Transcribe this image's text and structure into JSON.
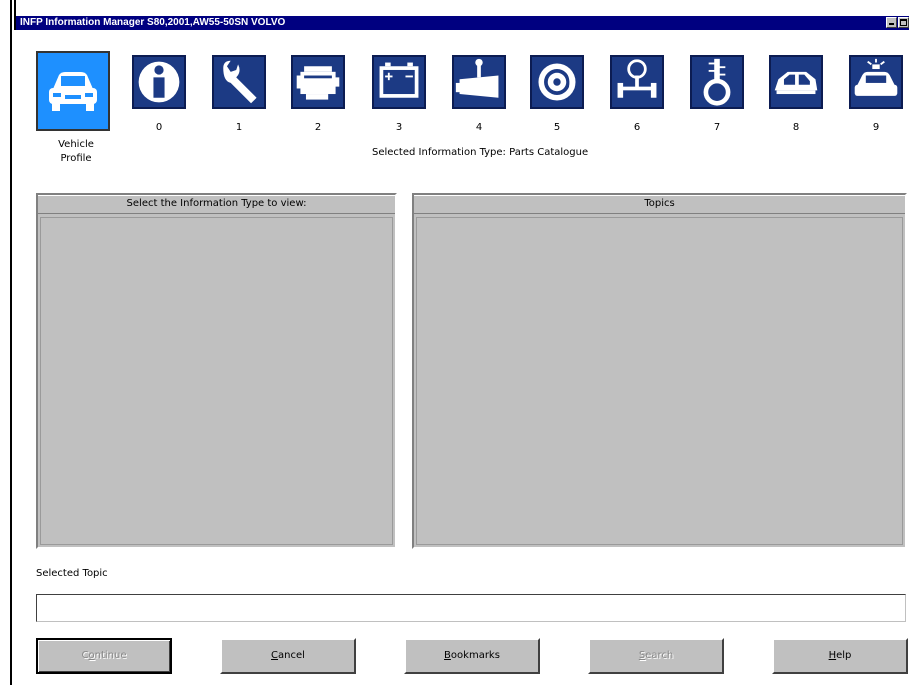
{
  "window": {
    "title": "INFP Information Manager S80,2001,AW55-50SN VOLVO"
  },
  "toolbar": {
    "vehicle_profile": {
      "line1": "Vehicle",
      "line2": "Profile",
      "icon": "car-front-icon"
    },
    "items": [
      {
        "number": "0",
        "icon": "info-icon"
      },
      {
        "number": "1",
        "icon": "wrench-icon"
      },
      {
        "number": "2",
        "icon": "engine-icon"
      },
      {
        "number": "3",
        "icon": "battery-icon"
      },
      {
        "number": "4",
        "icon": "transmission-icon"
      },
      {
        "number": "5",
        "icon": "brake-disc-icon"
      },
      {
        "number": "6",
        "icon": "steering-icon"
      },
      {
        "number": "7",
        "icon": "suspension-spring-icon"
      },
      {
        "number": "8",
        "icon": "car-body-icon"
      },
      {
        "number": "9",
        "icon": "police-car-icon"
      }
    ]
  },
  "selected_info": "Selected Information Type: Parts Catalogue",
  "panels": {
    "left_header": "Select the Information Type to view:",
    "right_header": "Topics"
  },
  "selected_topic": {
    "label": "Selected Topic",
    "value": ""
  },
  "buttons": {
    "continue": {
      "pre": "C",
      "ul": "o",
      "post": "ntinue"
    },
    "cancel": {
      "pre": "",
      "ul": "C",
      "post": "ancel"
    },
    "bookmarks": {
      "pre": "",
      "ul": "B",
      "post": "ookmarks"
    },
    "search": {
      "pre": "",
      "ul": "S",
      "post": "earch"
    },
    "help": {
      "pre": "",
      "ul": "H",
      "post": "elp"
    }
  },
  "colors": {
    "titlebar": "#000080",
    "icon_tile": "#1c3a84",
    "selected_tile": "#1e90ff",
    "panel": "#c0c0c0"
  }
}
